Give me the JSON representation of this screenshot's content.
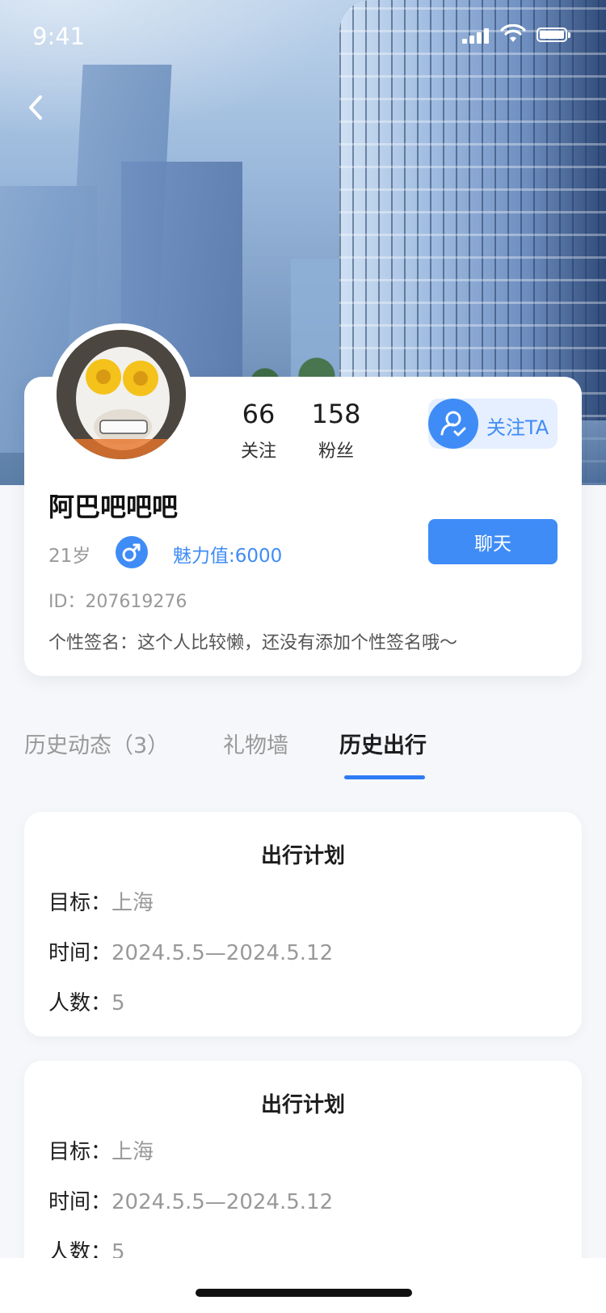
{
  "status_bar": {
    "time": "9:41"
  },
  "profile": {
    "following_count": "66",
    "following_label": "关注",
    "followers_count": "158",
    "followers_label": "粉丝",
    "follow_button": "关注TA",
    "name": "阿巴吧吧吧",
    "age": "21岁",
    "charm": "魅力值:6000",
    "chat_button": "聊天",
    "user_id": "ID：207619276",
    "signature": "个性签名：这个人比较懒，还没有添加个性签名哦～"
  },
  "tabs": [
    {
      "label": "历史动态（3）",
      "active": false
    },
    {
      "label": "礼物墙",
      "active": false
    },
    {
      "label": "历史出行",
      "active": true
    }
  ],
  "trips": [
    {
      "title": "出行计划",
      "target_label": "目标：",
      "target_value": "上海",
      "time_label": "时间：",
      "time_value": "2024.5.5—2024.5.12",
      "people_label": "人数：",
      "people_value": "5"
    },
    {
      "title": "出行计划",
      "target_label": "目标：",
      "target_value": "上海",
      "time_label": "时间：",
      "time_value": "2024.5.5—2024.5.12",
      "people_label": "人数：",
      "people_value": "5"
    }
  ],
  "colors": {
    "accent": "#3f8cf6",
    "background": "#f6f7fa"
  },
  "icons": [
    "back-arrow-icon",
    "signal-icon",
    "wifi-icon",
    "battery-icon",
    "user-check-icon",
    "male-gender-icon"
  ]
}
